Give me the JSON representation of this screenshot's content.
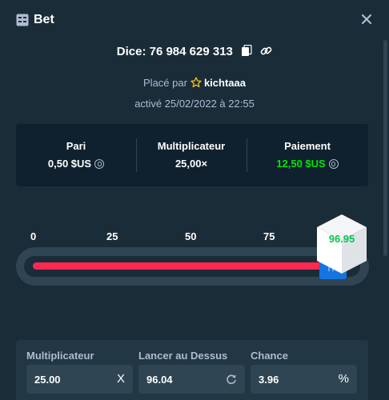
{
  "header": {
    "title": "Bet",
    "title_icon": "bet-slip-icon",
    "close_icon": "close-icon"
  },
  "dice": {
    "label": "Dice: 76 984 629 313",
    "copy_icon": "copy-icon",
    "link_icon": "link-icon"
  },
  "placed": {
    "prefix": "Placé par",
    "badge_icon": "star-icon",
    "user": "kichtaaa",
    "date": "activé 25/02/2022 à 22:55"
  },
  "stats": {
    "bet": {
      "label": "Pari",
      "value": "0,50 $US"
    },
    "multiplier": {
      "label": "Multiplicateur",
      "value": "25,00×"
    },
    "payout": {
      "label": "Paiement",
      "value": "12,50 $US"
    }
  },
  "slider": {
    "ticks": [
      "0",
      "25",
      "50",
      "75"
    ],
    "result": "96.95",
    "value": 96.04,
    "colors": {
      "lose": "#ff2851",
      "win": "#00e701",
      "handle": "#1475e1"
    }
  },
  "controls": {
    "multiplier": {
      "label": "Multiplicateur",
      "value": "25.00",
      "suffix": "X"
    },
    "roll_over": {
      "label": "Lancer au Dessus",
      "value": "96.04",
      "suffix_icon": "refresh-icon"
    },
    "chance": {
      "label": "Chance",
      "value": "3.96",
      "suffix": "%"
    }
  }
}
